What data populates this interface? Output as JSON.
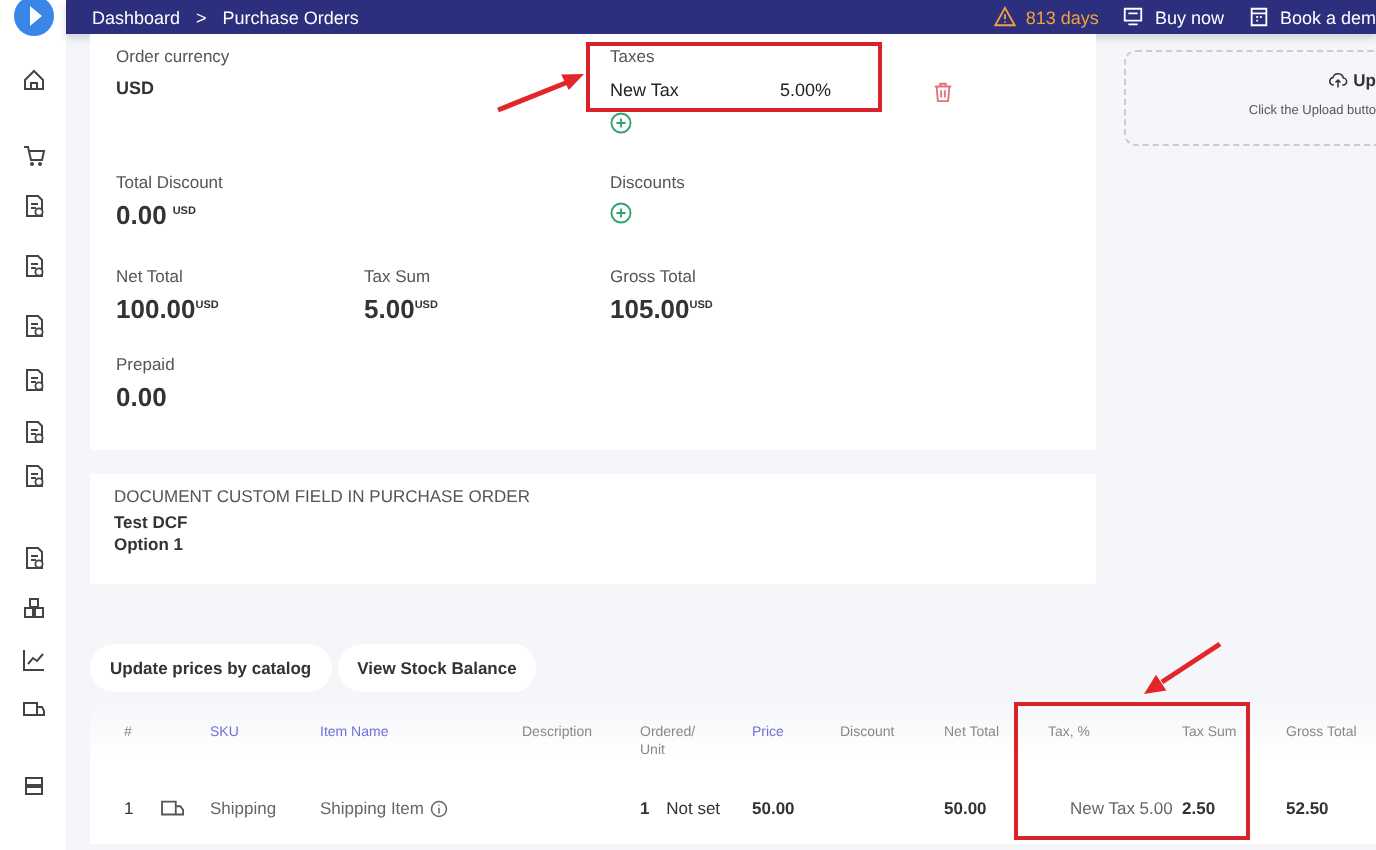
{
  "topbar": {
    "breadcrumb": [
      "Dashboard",
      "Purchase Orders"
    ],
    "separator": ">",
    "trial": "813 days",
    "buy_button": "Buy now",
    "demo_button": "Book a dem"
  },
  "summary": {
    "order_currency": {
      "label": "Order currency",
      "value": "USD"
    },
    "taxes": {
      "label": "Taxes",
      "items": [
        {
          "name": "New Tax",
          "rate": "5.00%"
        }
      ]
    },
    "total_discount": {
      "label": "Total Discount",
      "value": "0.00",
      "unit": "USD"
    },
    "discounts": {
      "label": "Discounts"
    },
    "net_total": {
      "label": "Net Total",
      "value": "100.00",
      "unit": "USD"
    },
    "tax_sum": {
      "label": "Tax Sum",
      "value": "5.00",
      "unit": "USD"
    },
    "gross_total": {
      "label": "Gross Total",
      "value": "105.00",
      "unit": "USD"
    },
    "prepaid": {
      "label": "Prepaid",
      "value": "0.00"
    }
  },
  "upload": {
    "button": "Up",
    "hint": "Click the Upload butto"
  },
  "custom_field": {
    "heading": "DOCUMENT CUSTOM FIELD IN PURCHASE ORDER",
    "name": "Test DCF",
    "value": "Option 1"
  },
  "actions": [
    "Update prices by catalog",
    "View Stock Balance"
  ],
  "table": {
    "columns": [
      {
        "label": "#",
        "link": false
      },
      {
        "label": "SKU",
        "link": true
      },
      {
        "label": "Item Name",
        "link": true
      },
      {
        "label": "Description",
        "link": false
      },
      {
        "label": "Ordered/\nUnit",
        "link": false
      },
      {
        "label": "Price",
        "link": true
      },
      {
        "label": "Discount",
        "link": false
      },
      {
        "label": "Net Total",
        "link": false
      },
      {
        "label": "Tax, %",
        "link": false
      },
      {
        "label": "Tax Sum",
        "link": false
      },
      {
        "label": "Gross Total",
        "link": false
      }
    ],
    "rows": [
      {
        "number": "1",
        "sku": "Shipping",
        "item_name": "Shipping Item",
        "quantity": "1",
        "unit": "Not set",
        "price": "50.00",
        "net_total": "50.00",
        "tax": "New Tax 5.00",
        "tax_sum": "2.50",
        "gross_total": "52.50"
      }
    ]
  }
}
